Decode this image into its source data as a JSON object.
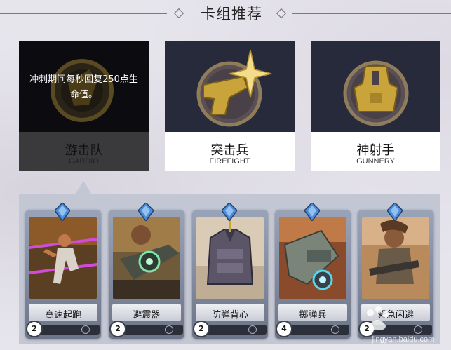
{
  "section_title": "卡组推荐",
  "decks": [
    {
      "name_cn": "游击队",
      "name_en": "CARDIO",
      "tooltip": "冲刺期间每秒回复250点生命值。",
      "icon": "running-boot-emblem",
      "active": true
    },
    {
      "name_cn": "突击兵",
      "name_en": "FIREFIGHT",
      "icon": "gun-starburst-emblem",
      "active": false
    },
    {
      "name_cn": "神射手",
      "name_en": "GUNNERY",
      "icon": "scope-emblem",
      "active": false
    }
  ],
  "cards": [
    {
      "name": "高速起跑",
      "cost": "2",
      "icon": "sprinting-hero-art"
    },
    {
      "name": "避震器",
      "cost": "2",
      "icon": "shock-absorber-art"
    },
    {
      "name": "防弹背心",
      "cost": "2",
      "icon": "bulletproof-vest-art"
    },
    {
      "name": "掷弹兵",
      "cost": "4",
      "icon": "grenade-launcher-art"
    },
    {
      "name": "紧急闪避",
      "cost": "2",
      "icon": "emergency-dodge-art"
    }
  ],
  "watermark": {
    "text": "jingyan.baidu.com",
    "icon": "baidu-paw-icon"
  },
  "colors": {
    "panel": "#c3c6d3",
    "deck_art_bg": "#262a3b",
    "active_label_bg": "#3a3a3c",
    "gold": "#c9a43a"
  }
}
